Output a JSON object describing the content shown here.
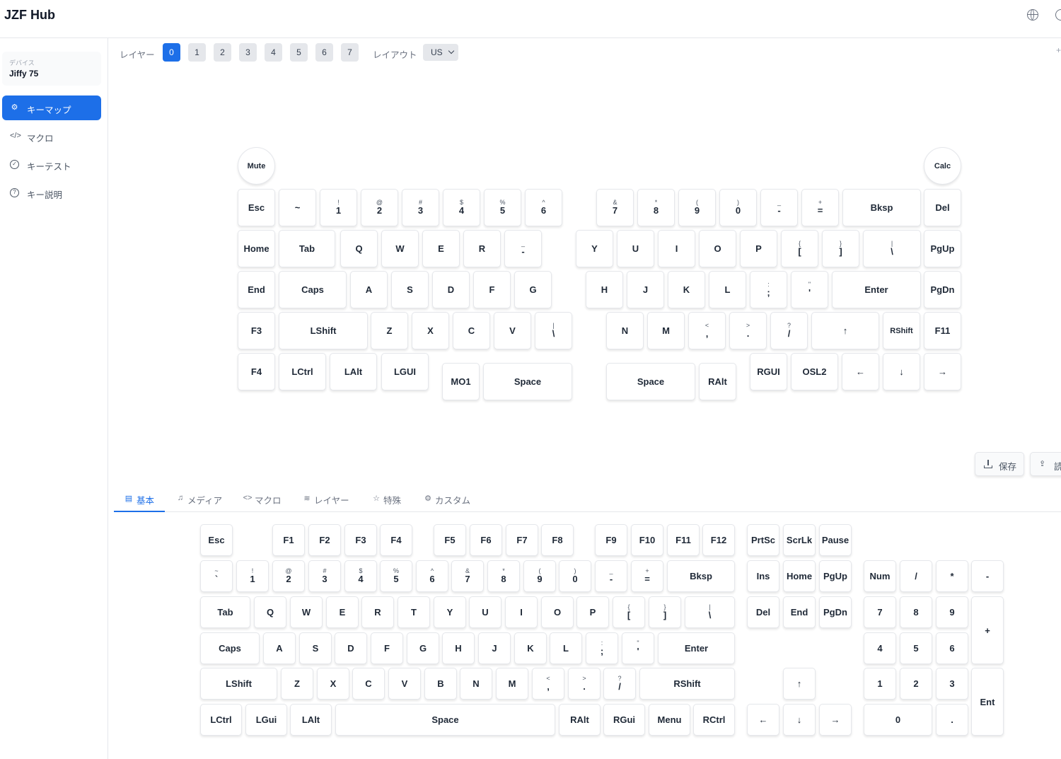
{
  "header": {
    "app_title": "JZF Hub",
    "language_icon": "globe-icon",
    "extra_icon": "theme-icon"
  },
  "sidebar": {
    "device_caption": "デバイス",
    "device_name": "Jiffy 75",
    "items": [
      {
        "label": "キーマップ",
        "icon": "keyboard-icon",
        "active": true
      },
      {
        "label": "マクロ",
        "icon": "code-icon",
        "active": false
      },
      {
        "label": "キーテスト",
        "icon": "check-circle-icon",
        "active": false
      },
      {
        "label": "キー説明",
        "icon": "help-circle-icon",
        "active": false
      }
    ]
  },
  "toolbar": {
    "layer_label": "レイヤー",
    "layers": [
      "0",
      "1",
      "2",
      "3",
      "4",
      "5",
      "6",
      "7"
    ],
    "active_layer": "0",
    "layout_label": "レイアウト",
    "layout_value": "US"
  },
  "actions": {
    "save_label": "保存",
    "load_label": "読"
  },
  "tabs": [
    {
      "label": "基本",
      "icon": "keyboard-icon",
      "active": true
    },
    {
      "label": "メディア",
      "icon": "music-icon",
      "active": false
    },
    {
      "label": "マクロ",
      "icon": "code-icon",
      "active": false
    },
    {
      "label": "レイヤー",
      "icon": "layers-icon",
      "active": false
    },
    {
      "label": "特殊",
      "icon": "star-icon",
      "active": false
    },
    {
      "label": "カスタム",
      "icon": "gear-icon",
      "active": false
    }
  ],
  "keymap_keys": [
    {
      "l": "Mute"
    },
    {
      "l": "Calc"
    },
    {
      "l": "Esc"
    },
    {
      "l": "~"
    },
    {
      "s": "!",
      "m": "1"
    },
    {
      "s": "@",
      "m": "2"
    },
    {
      "s": "#",
      "m": "3"
    },
    {
      "s": "$",
      "m": "4"
    },
    {
      "s": "%",
      "m": "5"
    },
    {
      "s": "^",
      "m": "6"
    },
    {
      "s": "&",
      "m": "7"
    },
    {
      "s": "*",
      "m": "8"
    },
    {
      "s": "(",
      "m": "9"
    },
    {
      "s": ")",
      "m": "0"
    },
    {
      "s": "_",
      "m": "-"
    },
    {
      "s": "+",
      "m": "="
    },
    {
      "l": "Bksp"
    },
    {
      "l": "Del"
    },
    {
      "l": "Home"
    },
    {
      "l": "Tab"
    },
    {
      "l": "Q"
    },
    {
      "l": "W"
    },
    {
      "l": "E"
    },
    {
      "l": "R"
    },
    {
      "s": "_",
      "m": "-"
    },
    {
      "l": "Y"
    },
    {
      "l": "U"
    },
    {
      "l": "I"
    },
    {
      "l": "O"
    },
    {
      "l": "P"
    },
    {
      "s": "{",
      "m": "["
    },
    {
      "s": "}",
      "m": "]"
    },
    {
      "s": "|",
      "m": "\\"
    },
    {
      "l": "PgUp"
    },
    {
      "l": "End"
    },
    {
      "l": "Caps"
    },
    {
      "l": "A"
    },
    {
      "l": "S"
    },
    {
      "l": "D"
    },
    {
      "l": "F"
    },
    {
      "l": "G"
    },
    {
      "l": "H"
    },
    {
      "l": "J"
    },
    {
      "l": "K"
    },
    {
      "l": "L"
    },
    {
      "s": ":",
      "m": ";"
    },
    {
      "s": "\"",
      "m": "'"
    },
    {
      "l": "Enter"
    },
    {
      "l": "PgDn"
    },
    {
      "l": "F3"
    },
    {
      "l": "LShift"
    },
    {
      "l": "Z"
    },
    {
      "l": "X"
    },
    {
      "l": "C"
    },
    {
      "l": "V"
    },
    {
      "s": "|",
      "m": "\\"
    },
    {
      "l": "N"
    },
    {
      "l": "M"
    },
    {
      "s": "<",
      "m": ","
    },
    {
      "s": ">",
      "m": "."
    },
    {
      "s": "?",
      "m": "/"
    },
    {
      "l": "↑"
    },
    {
      "l": "RShift"
    },
    {
      "l": "F11"
    },
    {
      "l": "F4"
    },
    {
      "l": "LCtrl"
    },
    {
      "l": "LAlt"
    },
    {
      "l": "LGUI"
    },
    {
      "l": "MO1"
    },
    {
      "l": "Space"
    },
    {
      "l": "Space"
    },
    {
      "l": "RAlt"
    },
    {
      "l": "RGUI"
    },
    {
      "l": "OSL2"
    },
    {
      "l": "←"
    },
    {
      "l": "↓"
    },
    {
      "l": "→"
    }
  ],
  "palette_keys": [
    {
      "l": "Esc"
    },
    {
      "l": "F1"
    },
    {
      "l": "F2"
    },
    {
      "l": "F3"
    },
    {
      "l": "F4"
    },
    {
      "l": "F5"
    },
    {
      "l": "F6"
    },
    {
      "l": "F7"
    },
    {
      "l": "F8"
    },
    {
      "l": "F9"
    },
    {
      "l": "F10"
    },
    {
      "l": "F11"
    },
    {
      "l": "F12"
    },
    {
      "l": "PrtSc"
    },
    {
      "l": "ScrLk"
    },
    {
      "l": "Pause"
    },
    {
      "s": "~",
      "m": "`"
    },
    {
      "s": "!",
      "m": "1"
    },
    {
      "s": "@",
      "m": "2"
    },
    {
      "s": "#",
      "m": "3"
    },
    {
      "s": "$",
      "m": "4"
    },
    {
      "s": "%",
      "m": "5"
    },
    {
      "s": "^",
      "m": "6"
    },
    {
      "s": "&",
      "m": "7"
    },
    {
      "s": "*",
      "m": "8"
    },
    {
      "s": "(",
      "m": "9"
    },
    {
      "s": ")",
      "m": "0"
    },
    {
      "s": "_",
      "m": "-"
    },
    {
      "s": "+",
      "m": "="
    },
    {
      "l": "Bksp"
    },
    {
      "l": "Ins"
    },
    {
      "l": "Home"
    },
    {
      "l": "PgUp"
    },
    {
      "l": "Num"
    },
    {
      "l": "/"
    },
    {
      "l": "*"
    },
    {
      "l": "-"
    },
    {
      "l": "Tab"
    },
    {
      "l": "Q"
    },
    {
      "l": "W"
    },
    {
      "l": "E"
    },
    {
      "l": "R"
    },
    {
      "l": "T"
    },
    {
      "l": "Y"
    },
    {
      "l": "U"
    },
    {
      "l": "I"
    },
    {
      "l": "O"
    },
    {
      "l": "P"
    },
    {
      "s": "{",
      "m": "["
    },
    {
      "s": "}",
      "m": "]"
    },
    {
      "s": "|",
      "m": "\\"
    },
    {
      "l": "Del"
    },
    {
      "l": "End"
    },
    {
      "l": "PgDn"
    },
    {
      "l": "7"
    },
    {
      "l": "8"
    },
    {
      "l": "9"
    },
    {
      "l": "+"
    },
    {
      "l": "Caps"
    },
    {
      "l": "A"
    },
    {
      "l": "S"
    },
    {
      "l": "D"
    },
    {
      "l": "F"
    },
    {
      "l": "G"
    },
    {
      "l": "H"
    },
    {
      "l": "J"
    },
    {
      "l": "K"
    },
    {
      "l": "L"
    },
    {
      "s": ":",
      "m": ";"
    },
    {
      "s": "\"",
      "m": "'"
    },
    {
      "l": "Enter"
    },
    {
      "l": "4"
    },
    {
      "l": "5"
    },
    {
      "l": "6"
    },
    {
      "l": "LShift"
    },
    {
      "l": "Z"
    },
    {
      "l": "X"
    },
    {
      "l": "C"
    },
    {
      "l": "V"
    },
    {
      "l": "B"
    },
    {
      "l": "N"
    },
    {
      "l": "M"
    },
    {
      "s": "<",
      "m": ","
    },
    {
      "s": ">",
      "m": "."
    },
    {
      "s": "?",
      "m": "/"
    },
    {
      "l": "RShift"
    },
    {
      "l": "↑"
    },
    {
      "l": "1"
    },
    {
      "l": "2"
    },
    {
      "l": "3"
    },
    {
      "l": "Ent"
    },
    {
      "l": "LCtrl"
    },
    {
      "l": "LGui"
    },
    {
      "l": "LAlt"
    },
    {
      "l": "Space"
    },
    {
      "l": "RAlt"
    },
    {
      "l": "RGui"
    },
    {
      "l": "Menu"
    },
    {
      "l": "RCtrl"
    },
    {
      "l": "←"
    },
    {
      "l": "↓"
    },
    {
      "l": "→"
    },
    {
      "l": "0"
    },
    {
      "l": "."
    }
  ],
  "colors": {
    "accent": "#1d6fe8",
    "key_border": "#e5e7eb",
    "muted_text": "#6b7280"
  }
}
